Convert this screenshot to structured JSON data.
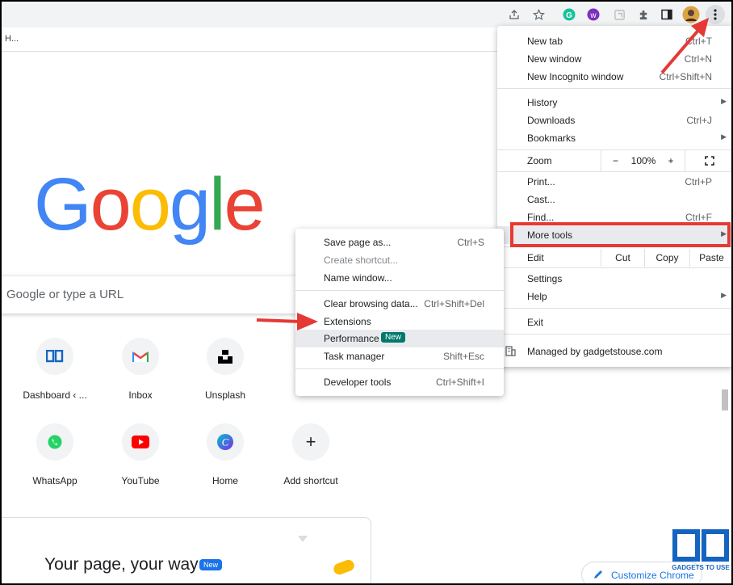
{
  "bookmarks_bar": {
    "item": "H..."
  },
  "logo": {
    "text": "Google"
  },
  "search": {
    "placeholder": "Google or type a URL"
  },
  "shortcuts": [
    {
      "label": "Dashboard ‹ ...",
      "icon": "gadgetstouse-icon"
    },
    {
      "label": "Inbox",
      "icon": "gmail-icon"
    },
    {
      "label": "Unsplash",
      "icon": "unsplash-icon"
    },
    {
      "label": "WhatsApp",
      "icon": "whatsapp-icon"
    },
    {
      "label": "YouTube",
      "icon": "youtube-icon"
    },
    {
      "label": "Home",
      "icon": "canva-icon"
    },
    {
      "label": "Add shortcut",
      "icon": "plus-icon"
    }
  ],
  "card": {
    "title": "Your page, your way",
    "badge": "New"
  },
  "customize_button": {
    "label": "Customize Chrome"
  },
  "menu": {
    "new_tab": {
      "label": "New tab",
      "shortcut": "Ctrl+T"
    },
    "new_window": {
      "label": "New window",
      "shortcut": "Ctrl+N"
    },
    "incognito": {
      "label": "New Incognito window",
      "shortcut": "Ctrl+Shift+N"
    },
    "history": {
      "label": "History"
    },
    "downloads": {
      "label": "Downloads",
      "shortcut": "Ctrl+J"
    },
    "bookmarks": {
      "label": "Bookmarks"
    },
    "zoom": {
      "label": "Zoom",
      "minus": "−",
      "value": "100%",
      "plus": "+"
    },
    "print": {
      "label": "Print...",
      "shortcut": "Ctrl+P"
    },
    "cast": {
      "label": "Cast..."
    },
    "find": {
      "label": "Find...",
      "shortcut": "Ctrl+F"
    },
    "more_tools": {
      "label": "More tools"
    },
    "edit": {
      "label": "Edit",
      "cut": "Cut",
      "copy": "Copy",
      "paste": "Paste"
    },
    "settings": {
      "label": "Settings"
    },
    "help": {
      "label": "Help"
    },
    "exit": {
      "label": "Exit"
    },
    "managed": {
      "label": "Managed by gadgetstouse.com"
    }
  },
  "submenu": {
    "save_page": {
      "label": "Save page as...",
      "shortcut": "Ctrl+S"
    },
    "create_shortcut": {
      "label": "Create shortcut..."
    },
    "name_window": {
      "label": "Name window..."
    },
    "clear_browsing": {
      "label": "Clear browsing data...",
      "shortcut": "Ctrl+Shift+Del"
    },
    "extensions": {
      "label": "Extensions"
    },
    "performance": {
      "label": "Performance",
      "badge": "New"
    },
    "task_manager": {
      "label": "Task manager",
      "shortcut": "Shift+Esc"
    },
    "developer_tools": {
      "label": "Developer tools",
      "shortcut": "Ctrl+Shift+I"
    }
  },
  "watermark": {
    "text": "GADGETS TO USE"
  },
  "colors": {
    "annotation_red": "#e53935",
    "new_badge_teal": "#00796b",
    "google_blue": "#4285f4",
    "google_red": "#ea4335",
    "google_yellow": "#fbbc05",
    "google_green": "#34a853"
  }
}
